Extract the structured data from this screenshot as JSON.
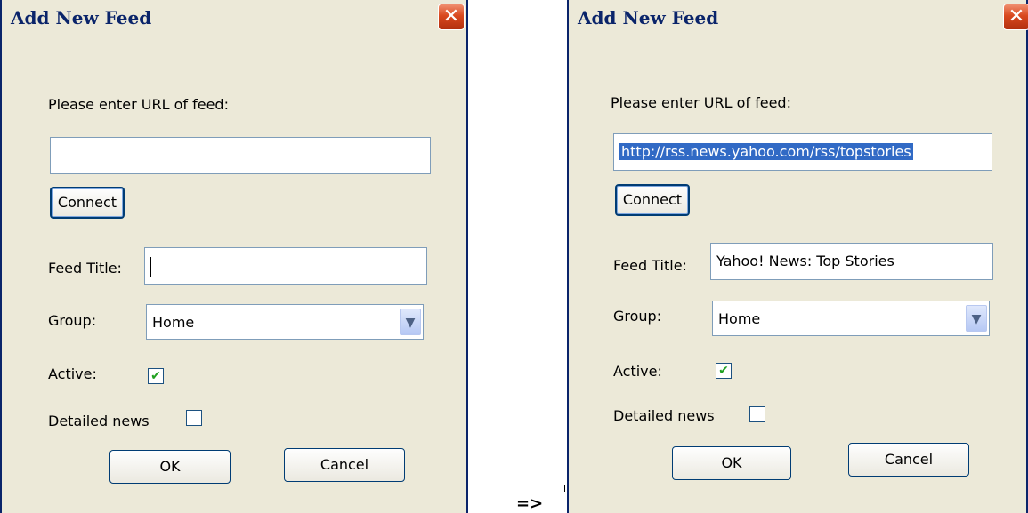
{
  "dialog_before": {
    "title": "Add New Feed",
    "close_label": "✕",
    "url_prompt": "Please enter URL of feed:",
    "url_value": "",
    "connect_label": "Connect",
    "feed_title_label": "Feed Title:",
    "feed_title_value": "",
    "group_label": "Group:",
    "group_value": "Home",
    "active_label": "Active:",
    "active_checked": "✔",
    "detailed_label": "Detailed news",
    "detailed_checked": "",
    "ok_label": "OK",
    "cancel_label": "Cancel"
  },
  "dialog_after": {
    "title": "Add New Feed",
    "close_label": "✕",
    "url_prompt": "Please enter URL of feed:",
    "url_value": "http://rss.news.yahoo.com/rss/topstories",
    "connect_label": "Connect",
    "feed_title_label": "Feed Title:",
    "feed_title_value": "Yahoo! News: Top Stories",
    "group_label": "Group:",
    "group_value": "Home",
    "active_label": "Active:",
    "active_checked": "✔",
    "detailed_label": "Detailed news",
    "detailed_checked": "",
    "ok_label": "OK",
    "cancel_label": "Cancel"
  },
  "transition_arrow": "=>",
  "icons": {
    "close": "close-icon",
    "dropdown": "chevron-down-icon",
    "check": "check-icon"
  },
  "colors": {
    "title_text": "#0a246a",
    "dialog_bg": "#ece9d8",
    "close_button": "#d9491f",
    "selection": "#316ac5",
    "checkmark": "#21a121"
  }
}
